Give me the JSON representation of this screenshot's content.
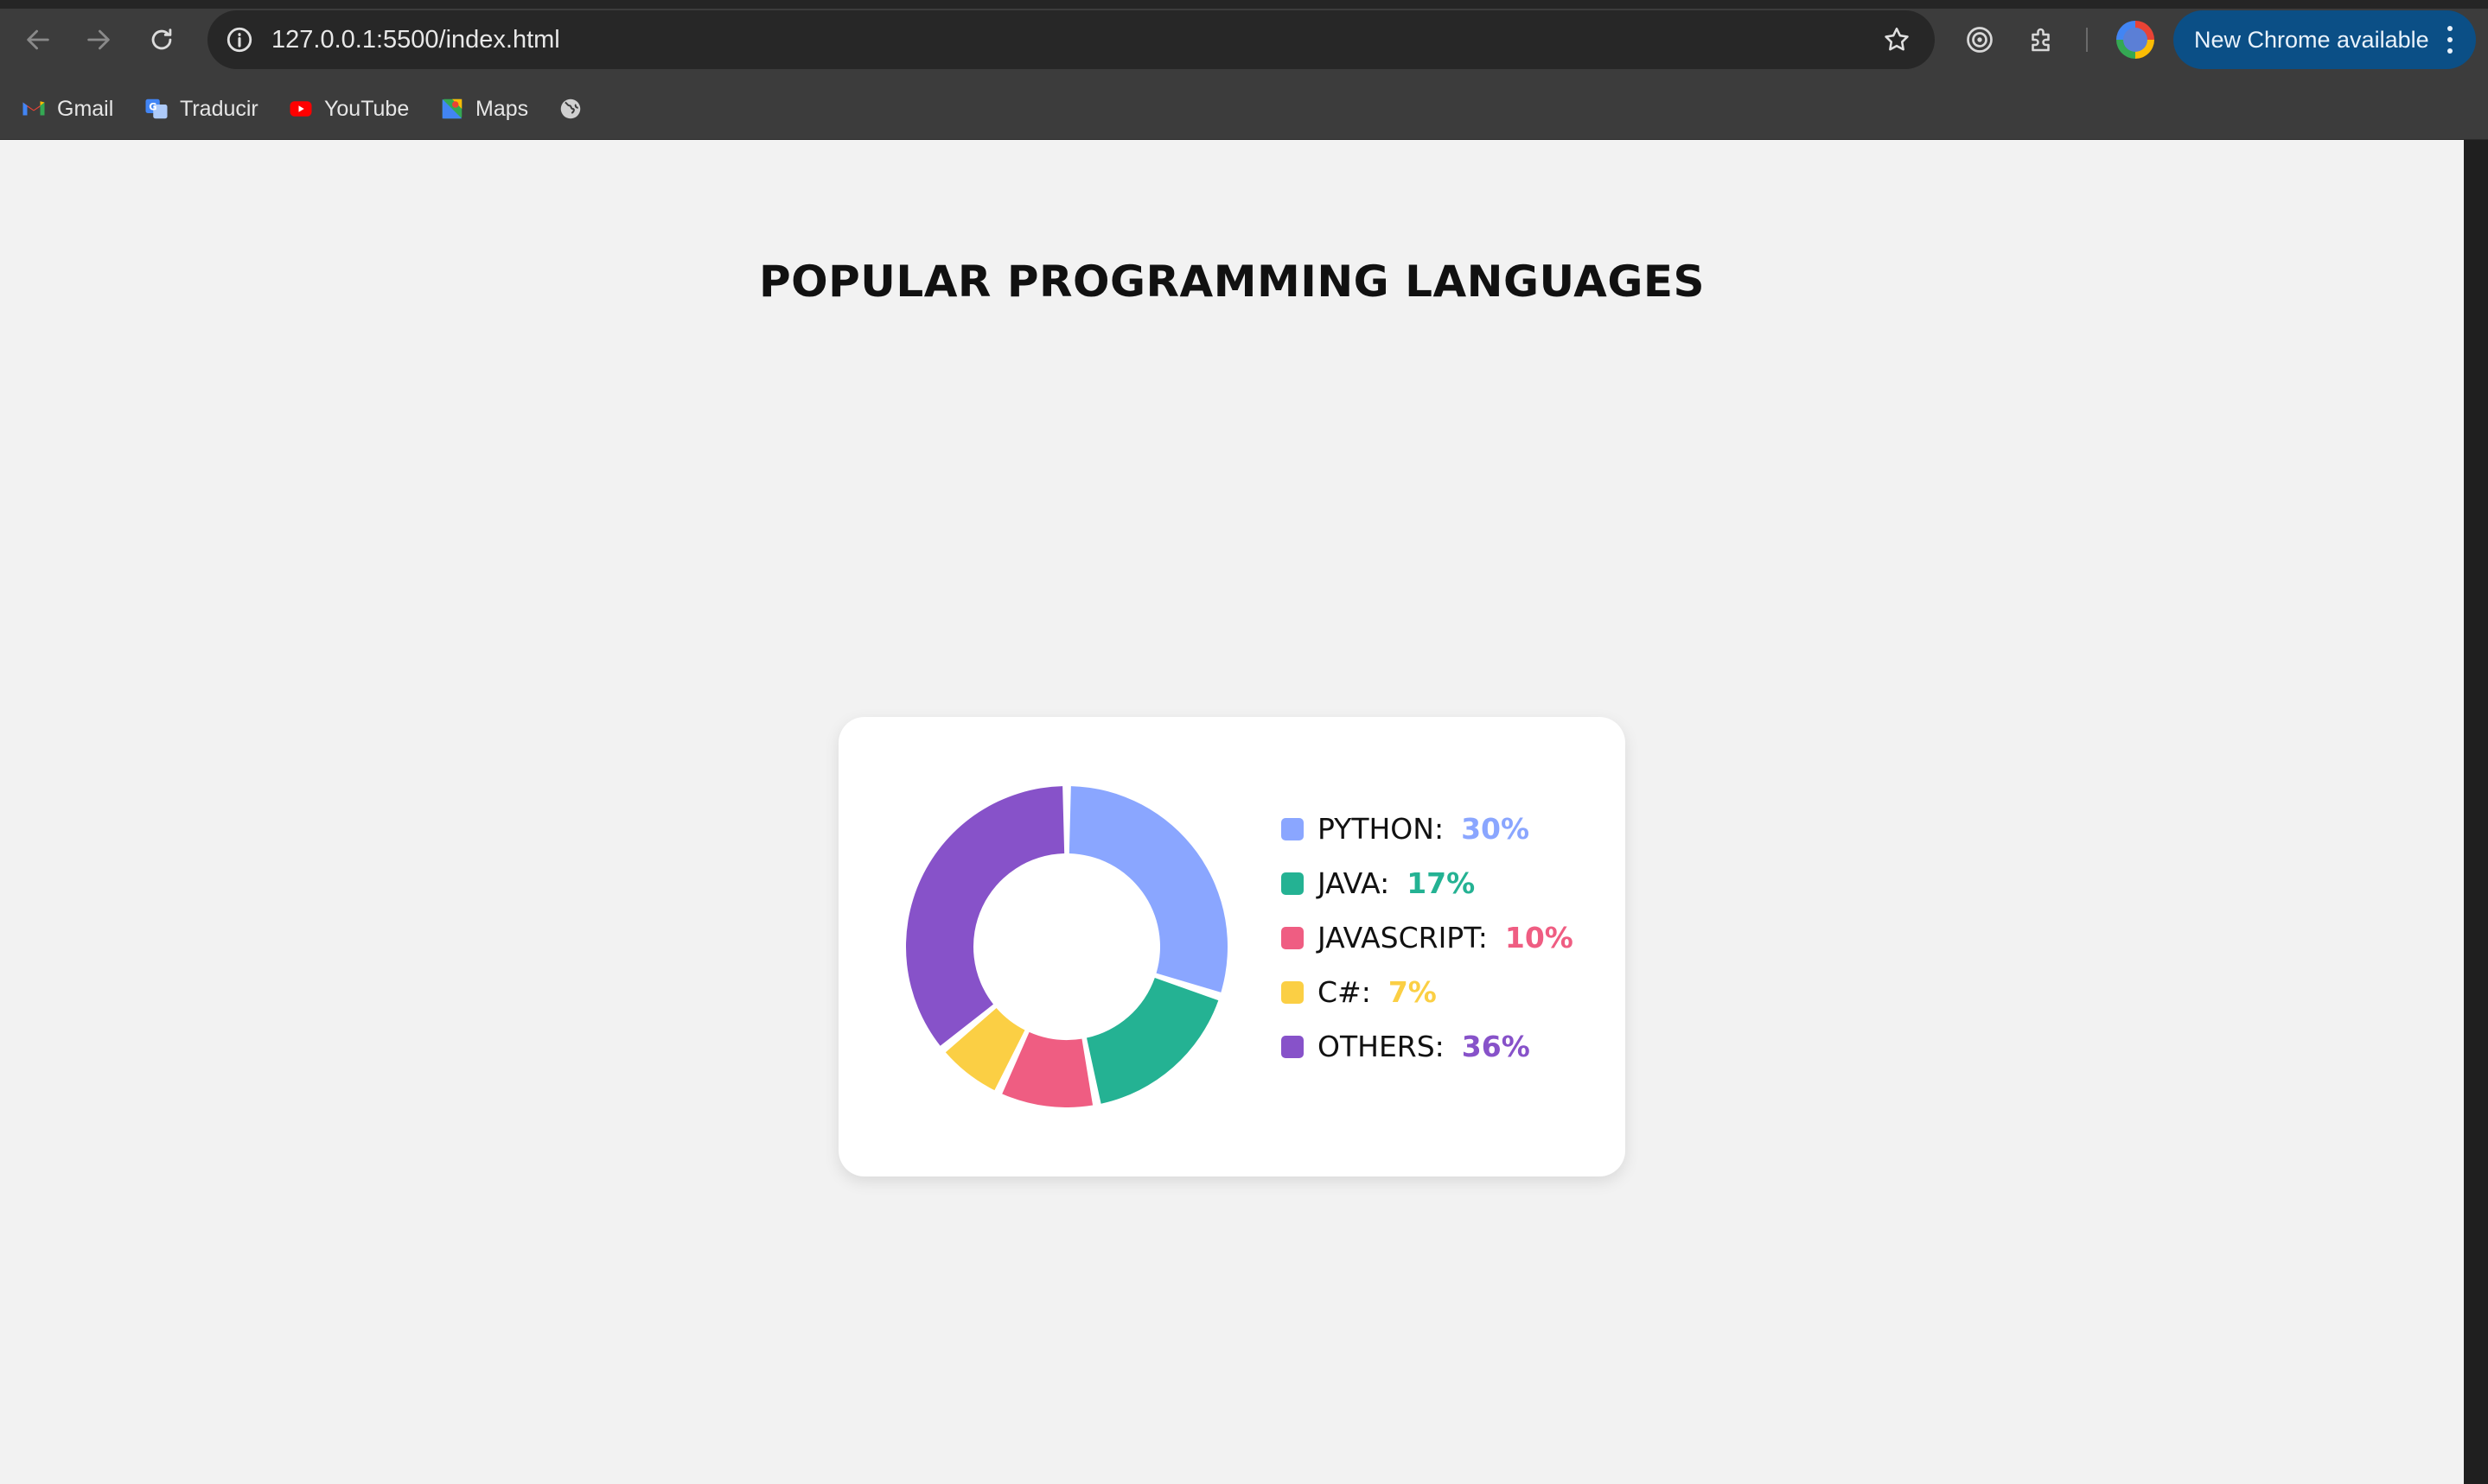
{
  "browser": {
    "url": "127.0.0.1:5500/index.html",
    "update_label": "New Chrome available",
    "bookmarks": [
      {
        "label": "Gmail",
        "icon": "gmail-icon"
      },
      {
        "label": "Traducir",
        "icon": "translate-icon"
      },
      {
        "label": "YouTube",
        "icon": "youtube-icon"
      },
      {
        "label": "Maps",
        "icon": "maps-icon"
      },
      {
        "label": "",
        "icon": "globe-icon"
      }
    ]
  },
  "page": {
    "title": "POPULAR PROGRAMMING LANGUAGES"
  },
  "chart_data": {
    "type": "pie",
    "variant": "donut",
    "categories": [
      "PYTHON",
      "JAVA",
      "JAVASCRIPT",
      "C#",
      "OTHERS"
    ],
    "values": [
      30,
      17,
      10,
      7,
      36
    ],
    "colors": [
      "#8aa6ff",
      "#24b293",
      "#ef5d82",
      "#fbcf44",
      "#8752c9"
    ],
    "legend": {
      "position": "right",
      "items": [
        {
          "name": "PYTHON:",
          "pct": "30%",
          "color": "#8aa6ff"
        },
        {
          "name": "JAVA:",
          "pct": "17%",
          "color": "#24b293"
        },
        {
          "name": "JAVASCRIPT:",
          "pct": "10%",
          "color": "#ef5d82"
        },
        {
          "name": "C#:",
          "pct": "7%",
          "color": "#fbcf44"
        },
        {
          "name": "OTHERS:",
          "pct": "36%",
          "color": "#8752c9"
        }
      ]
    }
  }
}
